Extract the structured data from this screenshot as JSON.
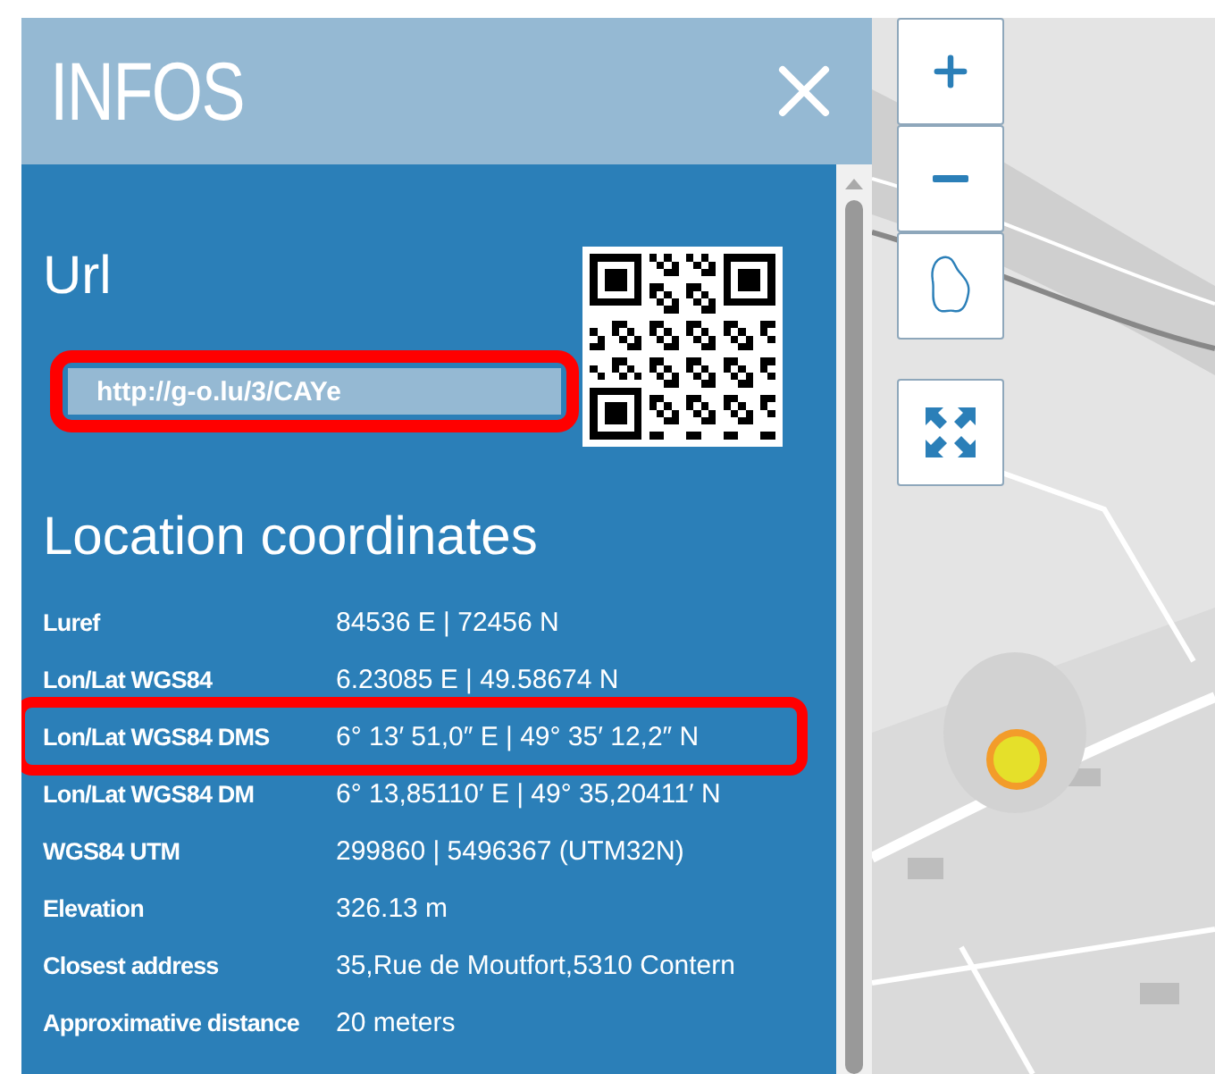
{
  "panel": {
    "title": "INFOS",
    "url_section": {
      "heading": "Url",
      "field_value": "http://g-o.lu/3/CAYe",
      "highlighted": true
    },
    "coordinates": {
      "heading": "Location coordinates",
      "rows": [
        {
          "label": "Luref",
          "value": "84536 E | 72456 N",
          "highlighted": false
        },
        {
          "label": "Lon/Lat WGS84",
          "value": "6.23085 E | 49.58674 N",
          "highlighted": false
        },
        {
          "label": "Lon/Lat WGS84 DMS",
          "value": "6° 13′ 51,0″ E | 49° 35′ 12,2″ N",
          "highlighted": true
        },
        {
          "label": "Lon/Lat WGS84 DM",
          "value": "6° 13,85110′ E | 49° 35,20411′ N",
          "highlighted": false
        },
        {
          "label": "WGS84 UTM",
          "value": "299860 | 5496367 (UTM32N)",
          "highlighted": false
        },
        {
          "label": "Elevation",
          "value": "326.13 m",
          "highlighted": false
        },
        {
          "label": "Closest address",
          "value": "35,Rue de Moutfort,5310 Contern",
          "highlighted": false
        },
        {
          "label": "Approximative distance",
          "value": "20 meters",
          "highlighted": false
        }
      ]
    }
  },
  "map": {
    "kind": "picture",
    "controls": [
      {
        "kind": "zoom-in"
      },
      {
        "kind": "zoom-out"
      },
      {
        "kind": "country"
      },
      {
        "kind": "fullscreen"
      }
    ]
  }
}
